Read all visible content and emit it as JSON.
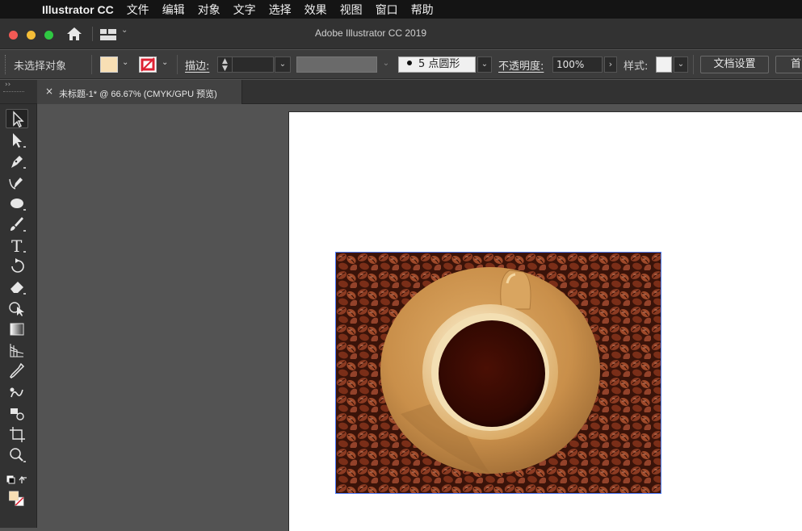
{
  "menubar": {
    "app_name": "Illustrator CC",
    "items": [
      "文件",
      "编辑",
      "对象",
      "文字",
      "选择",
      "效果",
      "视图",
      "窗口",
      "帮助"
    ]
  },
  "window": {
    "title": "Adobe Illustrator CC 2019"
  },
  "controlbar": {
    "selection_status": "未选择对象",
    "stroke_label": "描边:",
    "stroke_weight": "",
    "brush_label": "5 点圆形",
    "opacity_label": "不透明度:",
    "opacity_value": "100%",
    "style_label": "样式:",
    "document_setup_label": "文档设置",
    "preferences_label": "首",
    "fill_color": "#f8dfb4"
  },
  "document_tab": {
    "close_glyph": "×",
    "title": "未标题-1* @ 66.67% (CMYK/GPU 预览)"
  },
  "toolbar": {
    "tools": [
      "selection-tool",
      "direct-selection-tool",
      "pen-tool",
      "curvature-tool",
      "ellipse-tool",
      "paintbrush-tool",
      "type-tool",
      "rotate-tool",
      "eraser-tool",
      "shape-builder-tool",
      "gradient-tool",
      "perspective-grid-tool",
      "eyedropper-tool",
      "blend-tool",
      "symbol-sprayer-tool",
      "artboard-tool",
      "zoom-tool"
    ]
  },
  "colors": {
    "accent_selection": "#4f7fff",
    "fill_swatch": "#f8dfb4"
  }
}
